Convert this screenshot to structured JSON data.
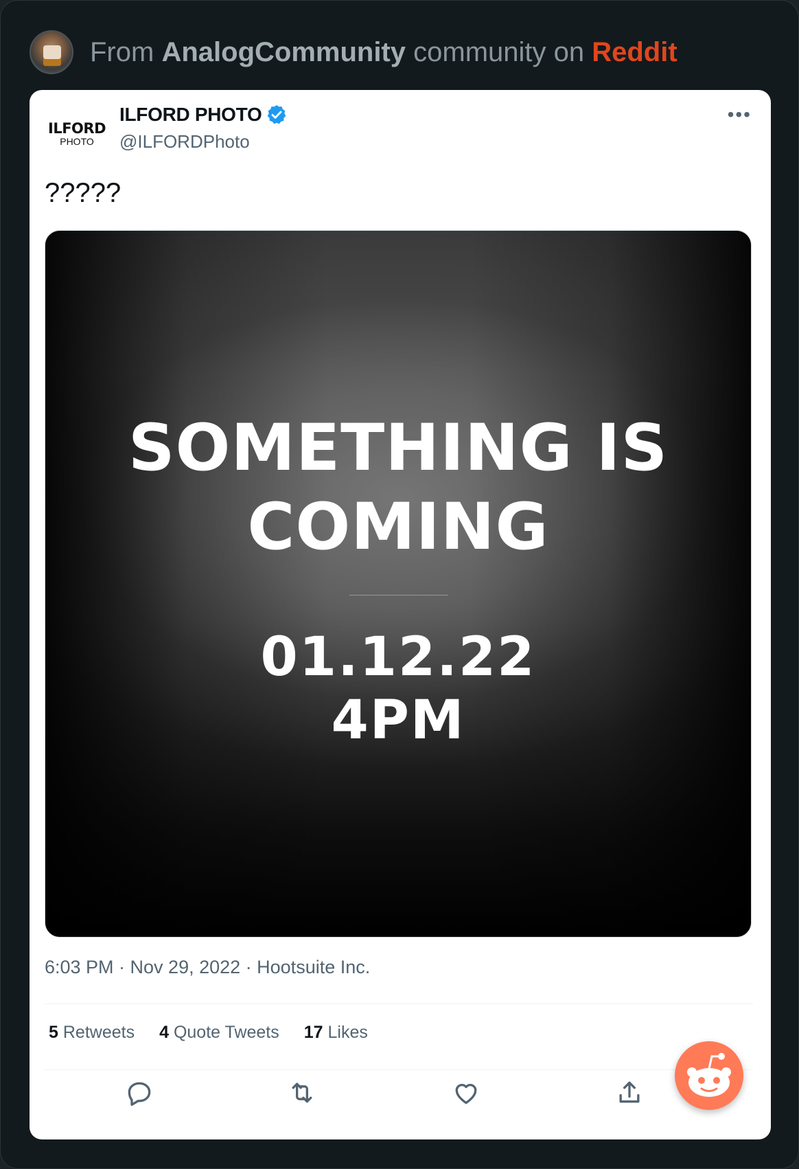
{
  "header": {
    "from_prefix": "From",
    "community": "AnalogCommunity",
    "community_word": "community on",
    "platform": "Reddit",
    "platform_color": "#e0461d"
  },
  "tweet": {
    "author_name": "ILFORD PHOTO",
    "author_handle": "@ILFORDPhoto",
    "logo_line1": "ILFORD",
    "logo_line2": "PHOTO",
    "more_label": "•••",
    "text": "?????",
    "image": {
      "line1": "SOMETHING IS",
      "line2": "COMING",
      "date": "01.12.22",
      "time": "4PM"
    },
    "meta": "6:03 PM · Nov 29, 2022 · Hootsuite Inc.",
    "stats": {
      "retweets_count": "5",
      "retweets_label": "Retweets",
      "quotes_count": "4",
      "quotes_label": "Quote Tweets",
      "likes_count": "17",
      "likes_label": "Likes"
    },
    "actions": [
      "reply-icon",
      "retweet-icon",
      "like-icon",
      "share-icon"
    ],
    "verified_color": "#1d9bf0"
  },
  "icons": {
    "avatar": "community-avatar",
    "reddit": "reddit-snoo-icon"
  }
}
